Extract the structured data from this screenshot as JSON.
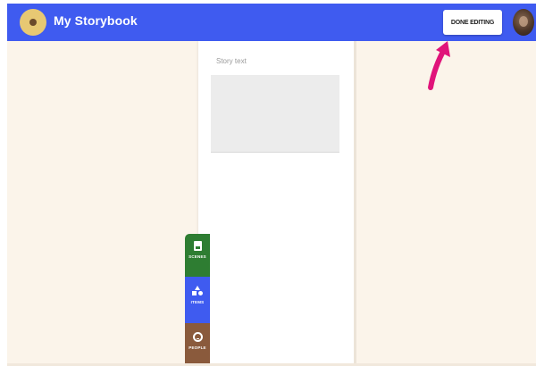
{
  "app": {
    "title": "My Storybook"
  },
  "header": {
    "done_label": "DONE EDITING"
  },
  "page": {
    "story_text_label": "Story text"
  },
  "side_tabs": [
    {
      "label": "SCENES",
      "icon": "scenes-icon",
      "color": "#2e7d32"
    },
    {
      "label": "ITEMS",
      "icon": "items-icon",
      "color": "#3f5bf0"
    },
    {
      "label": "PEOPLE",
      "icon": "people-icon",
      "color": "#8a5a3c"
    }
  ],
  "colors": {
    "topbar": "#3f5bf0",
    "canvas": "#fbf4ea",
    "annotation_arrow": "#e0147a"
  }
}
